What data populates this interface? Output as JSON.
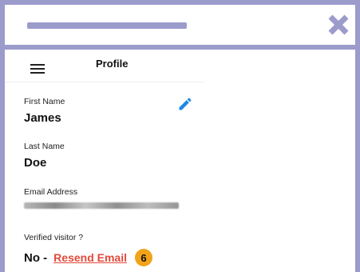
{
  "window": {
    "close_icon": "close-x-icon",
    "accent_color": "#9b9bcc"
  },
  "appbar": {
    "menu_icon": "hamburger-menu-icon",
    "title": "Profile"
  },
  "profile": {
    "edit_icon": "pencil-edit-icon",
    "first_name_label": "First Name",
    "first_name": "James",
    "last_name_label": "Last Name",
    "last_name": "Doe",
    "email_label": "Email Address",
    "verified_label": "Verified visitor ?",
    "verified_value": "No -",
    "resend_link": "Resend Email",
    "link_color": "#e24a3b"
  },
  "annotation": {
    "step_number": "6",
    "badge_color": "#f1a31b"
  }
}
